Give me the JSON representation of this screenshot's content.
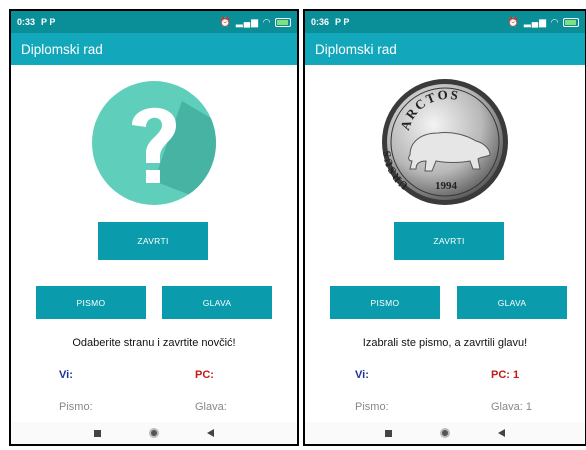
{
  "screens": [
    {
      "status": {
        "time": "0:33",
        "notif": "P P"
      },
      "app_title": "Diplomski rad",
      "image": "question-mark-icon",
      "spin_label": "ZAVRTI",
      "heads_label": "PISMO",
      "tails_label": "GLAVA",
      "message": "Odaberite stranu i zavrtite novčić!",
      "you_label": "Vi:",
      "pc_label": "PC:",
      "you_choice": "Pismo:",
      "pc_choice": "Glava:"
    },
    {
      "status": {
        "time": "0:36",
        "notif": "P P"
      },
      "app_title": "Diplomski rad",
      "image": "coin-bear-icon",
      "coin_text": {
        "top": "ARCTOS",
        "side": "URSUS",
        "year": "1994"
      },
      "spin_label": "ZAVRTI",
      "heads_label": "PISMO",
      "tails_label": "GLAVA",
      "message": "Izabrali ste pismo, a zavrtili glavu!",
      "you_label": "Vi:",
      "pc_label": "PC: 1",
      "you_choice": "Pismo:",
      "pc_choice": "Glava: 1"
    }
  ],
  "colors": {
    "statusbar": "#0a8f99",
    "appbar": "#12a7bb",
    "button": "#0a9cad",
    "you": "#1d2f9c",
    "pc": "#c21a1a"
  }
}
